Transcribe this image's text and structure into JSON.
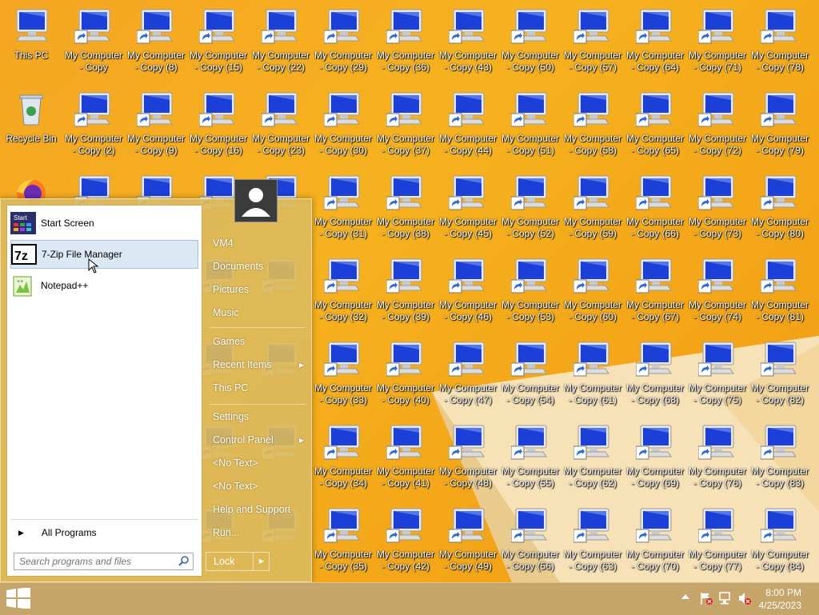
{
  "desktop": {
    "icons": [
      {
        "label": "This PC",
        "label2": "",
        "type": "pc",
        "shortcut": false
      },
      {
        "label": "Recycle Bin",
        "label2": "",
        "type": "bin",
        "shortcut": false
      },
      {
        "label": "",
        "label2": "",
        "type": "firefox",
        "shortcut": false
      },
      {
        "label": "My Computer",
        "label2": "- Copy",
        "type": "pc",
        "shortcut": true
      },
      {
        "label": "My Computer",
        "label2": "- Copy (2)",
        "type": "pc",
        "shortcut": true
      },
      {
        "label": "My Computer",
        "label2": "- Copy (8)",
        "type": "pc",
        "shortcut": true
      },
      {
        "label": "My Computer",
        "label2": "- Copy (9)",
        "type": "pc",
        "shortcut": true
      },
      {
        "label": "My Computer",
        "label2": "- Copy (15)",
        "type": "pc",
        "shortcut": true
      },
      {
        "label": "My Computer",
        "label2": "- Copy (16)",
        "type": "pc",
        "shortcut": true
      },
      {
        "label": "My Computer",
        "label2": "- Copy (22)",
        "type": "pc",
        "shortcut": true
      },
      {
        "label": "My Computer",
        "label2": "- Copy (23)",
        "type": "pc",
        "shortcut": true
      },
      {
        "label": "My Computer",
        "label2": "- Copy (29)",
        "type": "pc",
        "shortcut": true
      },
      {
        "label": "My Computer",
        "label2": "- Copy (30)",
        "type": "pc",
        "shortcut": true
      },
      {
        "label": "My Computer",
        "label2": "- Copy (31)",
        "type": "pc",
        "shortcut": true
      },
      {
        "label": "My Computer",
        "label2": "- Copy (32)",
        "type": "pc",
        "shortcut": true
      },
      {
        "label": "My Computer",
        "label2": "- Copy (33)",
        "type": "pc",
        "shortcut": true
      },
      {
        "label": "My Computer",
        "label2": "- Copy (34)",
        "type": "pc",
        "shortcut": true
      },
      {
        "label": "My Computer",
        "label2": "- Copy (35)",
        "type": "pc",
        "shortcut": true
      },
      {
        "label": "My Computer",
        "label2": "- Copy (36)",
        "type": "pc",
        "shortcut": true
      },
      {
        "label": "My Computer",
        "label2": "- Copy (37)",
        "type": "pc",
        "shortcut": true
      },
      {
        "label": "My Computer",
        "label2": "- Copy (38)",
        "type": "pc",
        "shortcut": true
      },
      {
        "label": "My Computer",
        "label2": "- Copy (39)",
        "type": "pc",
        "shortcut": true
      },
      {
        "label": "My Computer",
        "label2": "- Copy (40)",
        "type": "pc",
        "shortcut": true
      },
      {
        "label": "My Computer",
        "label2": "- Copy (41)",
        "type": "pc",
        "shortcut": true
      },
      {
        "label": "My Computer",
        "label2": "- Copy (42)",
        "type": "pc",
        "shortcut": true
      },
      {
        "label": "My Computer",
        "label2": "- Copy (43)",
        "type": "pc",
        "shortcut": true
      },
      {
        "label": "My Computer",
        "label2": "- Copy (44)",
        "type": "pc",
        "shortcut": true
      },
      {
        "label": "My Computer",
        "label2": "- Copy (45)",
        "type": "pc",
        "shortcut": true
      },
      {
        "label": "My Computer",
        "label2": "- Copy (46)",
        "type": "pc",
        "shortcut": true
      },
      {
        "label": "My Computer",
        "label2": "- Copy (47)",
        "type": "pc",
        "shortcut": true
      },
      {
        "label": "My Computer",
        "label2": "- Copy (48)",
        "type": "pc",
        "shortcut": true
      },
      {
        "label": "My Computer",
        "label2": "- Copy (49)",
        "type": "pc",
        "shortcut": true
      },
      {
        "label": "My Computer",
        "label2": "- Copy (50)",
        "type": "pc",
        "shortcut": true
      },
      {
        "label": "My Computer",
        "label2": "- Copy (51)",
        "type": "pc",
        "shortcut": true
      },
      {
        "label": "My Computer",
        "label2": "- Copy (52)",
        "type": "pc",
        "shortcut": true
      },
      {
        "label": "My Computer",
        "label2": "- Copy (53)",
        "type": "pc",
        "shortcut": true
      },
      {
        "label": "My Computer",
        "label2": "- Copy (54)",
        "type": "pc",
        "shortcut": true
      },
      {
        "label": "My Computer",
        "label2": "- Copy (55)",
        "type": "pc",
        "shortcut": true
      },
      {
        "label": "My Computer",
        "label2": "- Copy (56)",
        "type": "pc",
        "shortcut": true
      },
      {
        "label": "My Computer",
        "label2": "- Copy (57)",
        "type": "pc",
        "shortcut": true
      },
      {
        "label": "My Computer",
        "label2": "- Copy (58)",
        "type": "pc",
        "shortcut": true
      },
      {
        "label": "My Computer",
        "label2": "- Copy (59)",
        "type": "pc",
        "shortcut": true
      },
      {
        "label": "My Computer",
        "label2": "- Copy (60)",
        "type": "pc",
        "shortcut": true
      },
      {
        "label": "My Computer",
        "label2": "- Copy (61)",
        "type": "pc",
        "shortcut": true
      },
      {
        "label": "My Computer",
        "label2": "- Copy (62)",
        "type": "pc",
        "shortcut": true
      },
      {
        "label": "My Computer",
        "label2": "- Copy (63)",
        "type": "pc",
        "shortcut": true
      },
      {
        "label": "My Computer",
        "label2": "- Copy (64)",
        "type": "pc",
        "shortcut": true
      },
      {
        "label": "My Computer",
        "label2": "- Copy (65)",
        "type": "pc",
        "shortcut": true
      },
      {
        "label": "My Computer",
        "label2": "- Copy (66)",
        "type": "pc",
        "shortcut": true
      },
      {
        "label": "My Computer",
        "label2": "- Copy (67)",
        "type": "pc",
        "shortcut": true
      },
      {
        "label": "My Computer",
        "label2": "- Copy (68)",
        "type": "pc",
        "shortcut": true
      },
      {
        "label": "My Computer",
        "label2": "- Copy (69)",
        "type": "pc",
        "shortcut": true
      },
      {
        "label": "My Computer",
        "label2": "- Copy (70)",
        "type": "pc",
        "shortcut": true
      },
      {
        "label": "My Computer",
        "label2": "- Copy (71)",
        "type": "pc",
        "shortcut": true
      },
      {
        "label": "My Computer",
        "label2": "- Copy (72)",
        "type": "pc",
        "shortcut": true
      },
      {
        "label": "My Computer",
        "label2": "- Copy (73)",
        "type": "pc",
        "shortcut": true
      },
      {
        "label": "My Computer",
        "label2": "- Copy (74)",
        "type": "pc",
        "shortcut": true
      },
      {
        "label": "My Computer",
        "label2": "- Copy (75)",
        "type": "pc",
        "shortcut": true
      },
      {
        "label": "My Computer",
        "label2": "- Copy (76)",
        "type": "pc",
        "shortcut": true
      },
      {
        "label": "My Computer",
        "label2": "- Copy (77)",
        "type": "pc",
        "shortcut": true
      },
      {
        "label": "My Computer",
        "label2": "- Copy (78)",
        "type": "pc",
        "shortcut": true
      },
      {
        "label": "My Computer",
        "label2": "- Copy (79)",
        "type": "pc",
        "shortcut": true
      },
      {
        "label": "My Computer",
        "label2": "- Copy (80)",
        "type": "pc",
        "shortcut": true
      },
      {
        "label": "My Computer",
        "label2": "- Copy (81)",
        "type": "pc",
        "shortcut": true
      },
      {
        "label": "My Computer",
        "label2": "- Copy (82)",
        "type": "pc",
        "shortcut": true
      },
      {
        "label": "My Computer",
        "label2": "- Copy (83)",
        "type": "pc",
        "shortcut": true
      },
      {
        "label": "My Computer",
        "label2": "- Copy (84)",
        "type": "pc",
        "shortcut": true
      }
    ]
  },
  "start_menu": {
    "pinned": [
      {
        "label": "Start Screen",
        "icon": "start-screen-icon",
        "selected": false
      },
      {
        "label": "7-Zip File Manager",
        "icon": "7zip-icon",
        "selected": true
      },
      {
        "label": "Notepad++",
        "icon": "notepadpp-icon",
        "selected": false
      }
    ],
    "all_programs": "All Programs",
    "search_placeholder": "Search programs and files",
    "right": [
      {
        "label": "VM4",
        "arrow": false
      },
      {
        "label": "Documents",
        "arrow": false
      },
      {
        "label": "Pictures",
        "arrow": false
      },
      {
        "label": "Music",
        "arrow": false
      },
      {
        "label": "Games",
        "arrow": false
      },
      {
        "label": "Recent Items",
        "arrow": true
      },
      {
        "label": "This PC",
        "arrow": false
      },
      {
        "label": "Settings",
        "arrow": false
      },
      {
        "label": "Control Panel",
        "arrow": true
      },
      {
        "label": "<No Text>",
        "arrow": false
      },
      {
        "label": "<No Text>",
        "arrow": false
      },
      {
        "label": "Help and Support",
        "arrow": false
      },
      {
        "label": "Run...",
        "arrow": false
      }
    ],
    "lock_label": "Lock"
  },
  "taskbar": {
    "time": "8:00 PM",
    "date": "4/25/2023"
  },
  "colors": {
    "desktop_accent": "#f5a623",
    "taskbar": "#c6a56a",
    "monitor_blue": "#1c3fd8"
  }
}
